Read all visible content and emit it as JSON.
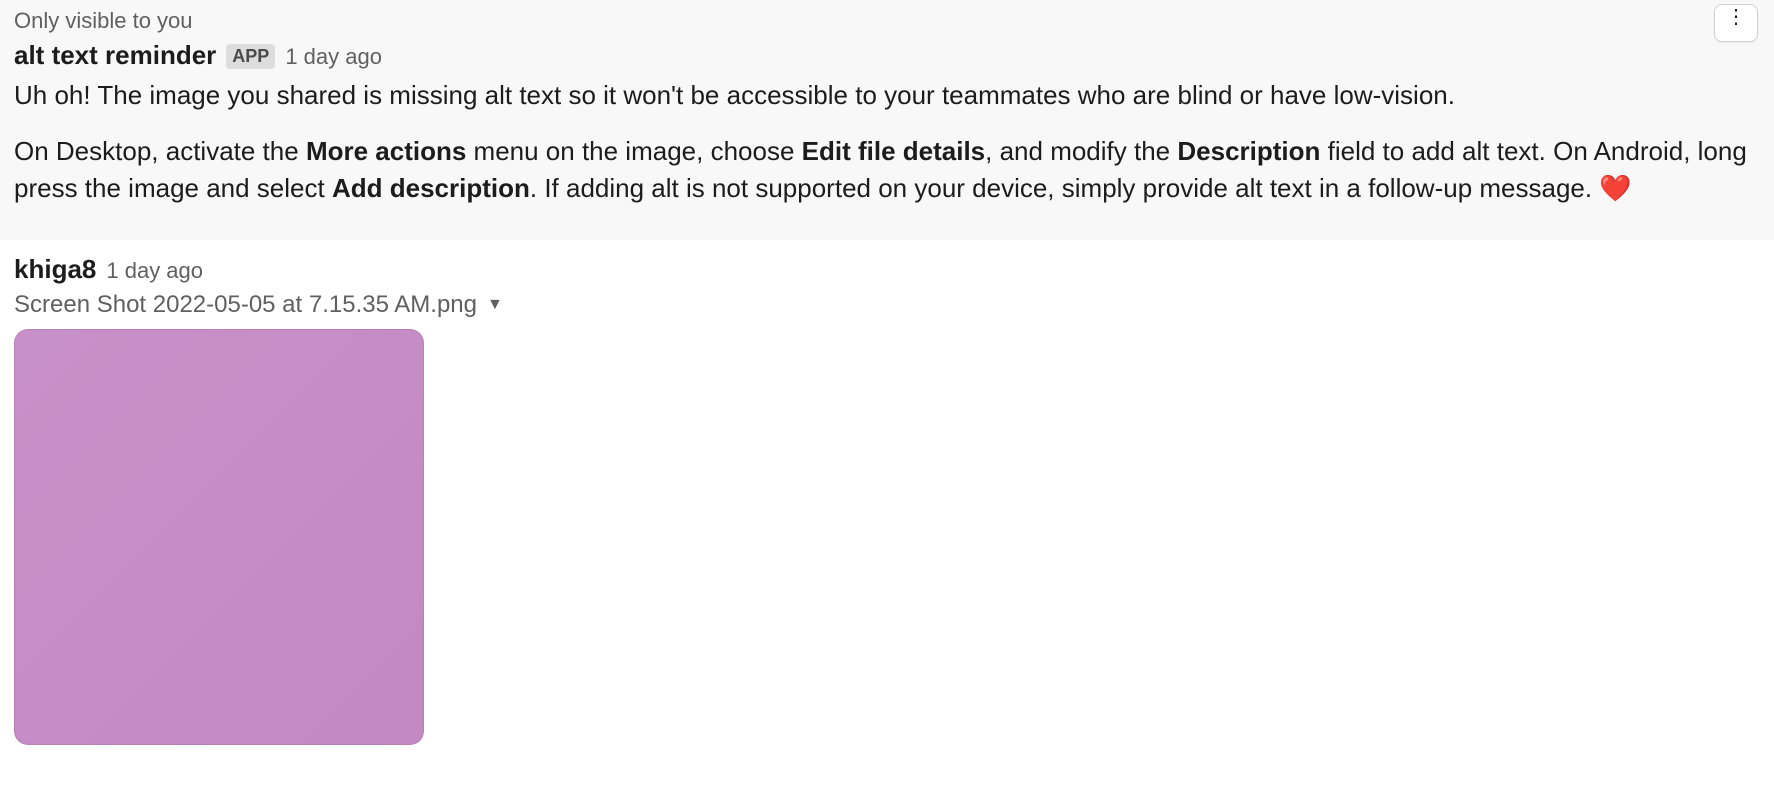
{
  "ephemeral": {
    "visibility_note": "Only visible to you",
    "sender": "alt text reminder",
    "app_badge": "APP",
    "timestamp": "1 day ago",
    "body_para1": "Uh oh! The image you shared is missing alt text so it won't be accessible to your teammates who are blind or have low-vision.",
    "body_para2_prefix": "On Desktop, activate the ",
    "body_para2_bold1": "More actions",
    "body_para2_mid1": " menu on the image, choose ",
    "body_para2_bold2": "Edit file details",
    "body_para2_mid2": ", and modify the ",
    "body_para2_bold3": "Description",
    "body_para2_mid3": " field to add alt text. On Android, long press the image and select ",
    "body_para2_bold4": "Add description",
    "body_para2_suffix": ". If adding alt is not supported on your device, simply provide alt text in a follow-up message. ",
    "heart": "❤️"
  },
  "message2": {
    "sender": "khiga8",
    "timestamp": "1 day ago",
    "file_name": "Screen Shot 2022-05-05 at 7.15.35 AM.png"
  }
}
